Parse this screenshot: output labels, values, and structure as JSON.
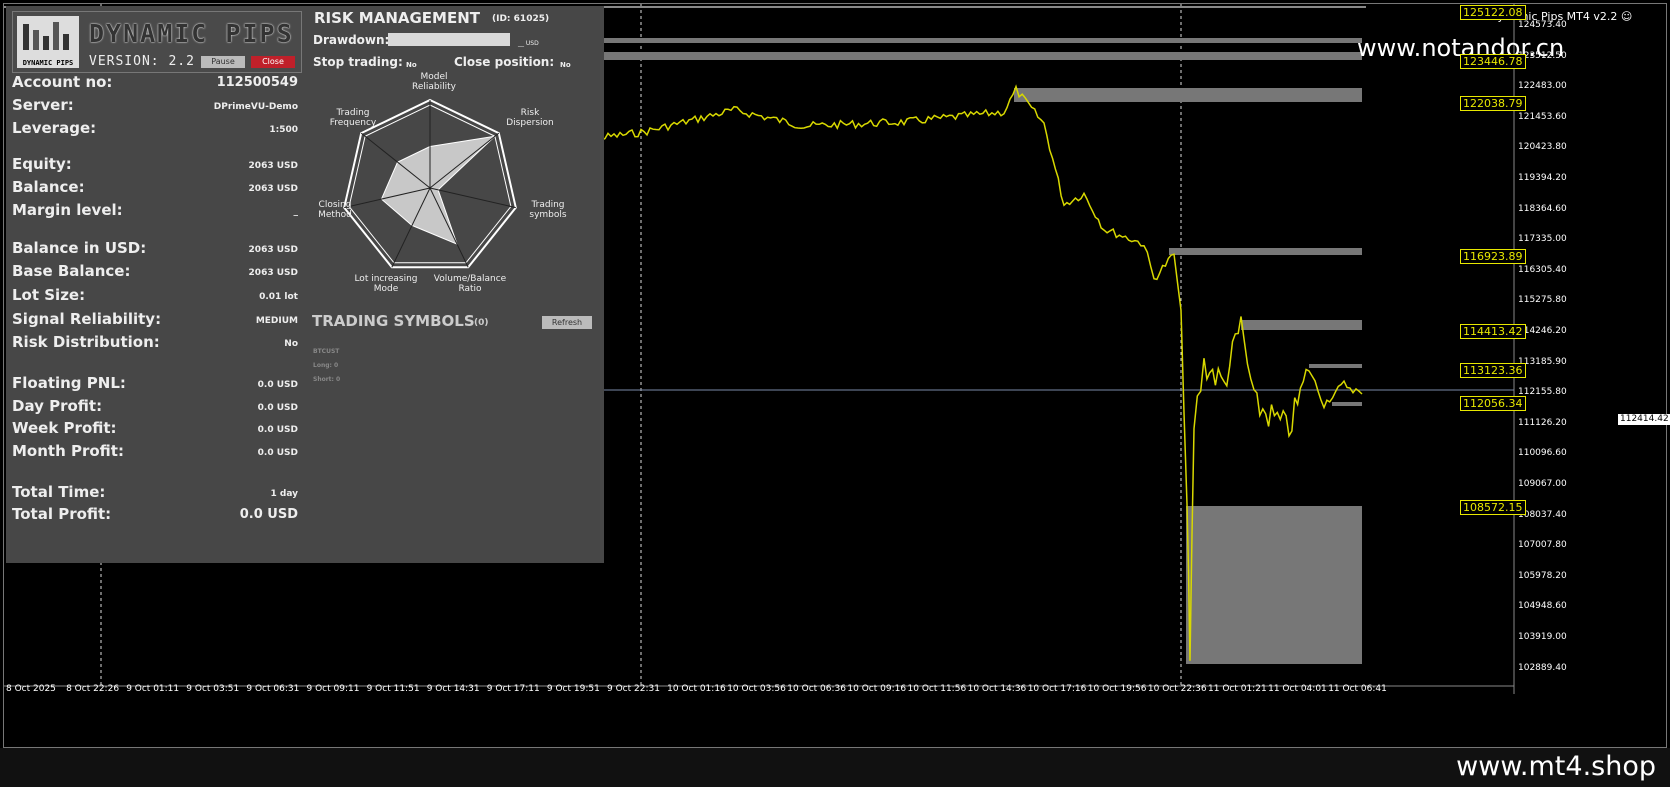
{
  "watermarks": {
    "top": "www.notandor.cn",
    "footer": "www.mt4.shop"
  },
  "ea_title": "Dynamic Pips MT4 v2.2 ☺",
  "current_price": "112414.42",
  "price_axis": [
    "124573.40",
    "123512.50",
    "122483.00",
    "121453.60",
    "120423.80",
    "119394.20",
    "118364.60",
    "117335.00",
    "116305.40",
    "115275.80",
    "114246.20",
    "113185.90",
    "112155.80",
    "111126.20",
    "110096.60",
    "109067.00",
    "108037.40",
    "107007.80",
    "105978.20",
    "104948.60",
    "103919.00",
    "102889.40"
  ],
  "time_axis": [
    "8 Oct 2025",
    "8 Oct 22:26",
    "9 Oct 01:11",
    "9 Oct 03:51",
    "9 Oct 06:31",
    "9 Oct 09:11",
    "9 Oct 11:51",
    "9 Oct 14:31",
    "9 Oct 17:11",
    "9 Oct 19:51",
    "9 Oct 22:31",
    "10 Oct 01:16",
    "10 Oct 03:56",
    "10 Oct 06:36",
    "10 Oct 09:16",
    "10 Oct 11:56",
    "10 Oct 14:36",
    "10 Oct 17:16",
    "10 Oct 19:56",
    "10 Oct 22:36",
    "11 Oct 01:21",
    "11 Oct 04:01",
    "11 Oct 06:41"
  ],
  "level_tags": [
    "125122.08",
    "123446.78",
    "122038.79",
    "116923.89",
    "114413.42",
    "113123.36",
    "112056.34",
    "108572.15"
  ],
  "logo": {
    "name": "DYNAMIC PIPS",
    "version": "VERSION: 2.2",
    "icon_text": "DYNAMIC PIPS"
  },
  "buttons": {
    "pause": "Pause",
    "close": "Close",
    "refresh": "Refresh"
  },
  "account": [
    {
      "label": "Account no:",
      "value": "112500549"
    },
    {
      "label": "Server:",
      "value": "DPrimeVU-Demo"
    },
    {
      "label": "Leverage:",
      "value": "1:500"
    },
    {
      "label": "Equity:",
      "value": "2063 USD"
    },
    {
      "label": "Balance:",
      "value": "2063 USD"
    },
    {
      "label": "Margin level:",
      "value": "_"
    },
    {
      "label": "Balance in USD:",
      "value": "2063 USD"
    },
    {
      "label": "Base Balance:",
      "value": "2063 USD"
    },
    {
      "label": "Lot Size:",
      "value": "0.01 lot"
    },
    {
      "label": "Signal Reliability:",
      "value": "MEDIUM"
    },
    {
      "label": "Risk Distribution:",
      "value": "No"
    },
    {
      "label": "Floating PNL:",
      "value": "0.0 USD"
    },
    {
      "label": "Day Profit:",
      "value": "0.0 USD"
    },
    {
      "label": "Week Profit:",
      "value": "0.0 USD"
    },
    {
      "label": "Month Profit:",
      "value": "0.0 USD"
    },
    {
      "label": "Total Time:",
      "value": "1 day"
    },
    {
      "label": "Total Profit:",
      "value": "0.0 USD"
    }
  ],
  "risk": {
    "title": "RISK MANAGEMENT",
    "id": "(ID: 61025)",
    "drawdown_label": "Drawdown:",
    "drawdown_unit": "__ USD",
    "stop_label": "Stop trading:",
    "stop_value": "No",
    "closepos_label": "Close position:",
    "closepos_value": "No",
    "radar_axes": [
      "Model Reliability",
      "Risk Dispersion",
      "Trading symbols",
      "Volume/Balance Ratio",
      "Lot increasing Mode",
      "Closing Method",
      "Trading Frequency"
    ],
    "radar_values": [
      0.5,
      1.0,
      0.1,
      0.75,
      0.5,
      0.6,
      0.5
    ]
  },
  "symbols": {
    "title": "TRADING SYMBOLS",
    "count": "(0)",
    "lines": [
      "BTCUST",
      "Long: 0",
      "Short: 0"
    ]
  }
}
